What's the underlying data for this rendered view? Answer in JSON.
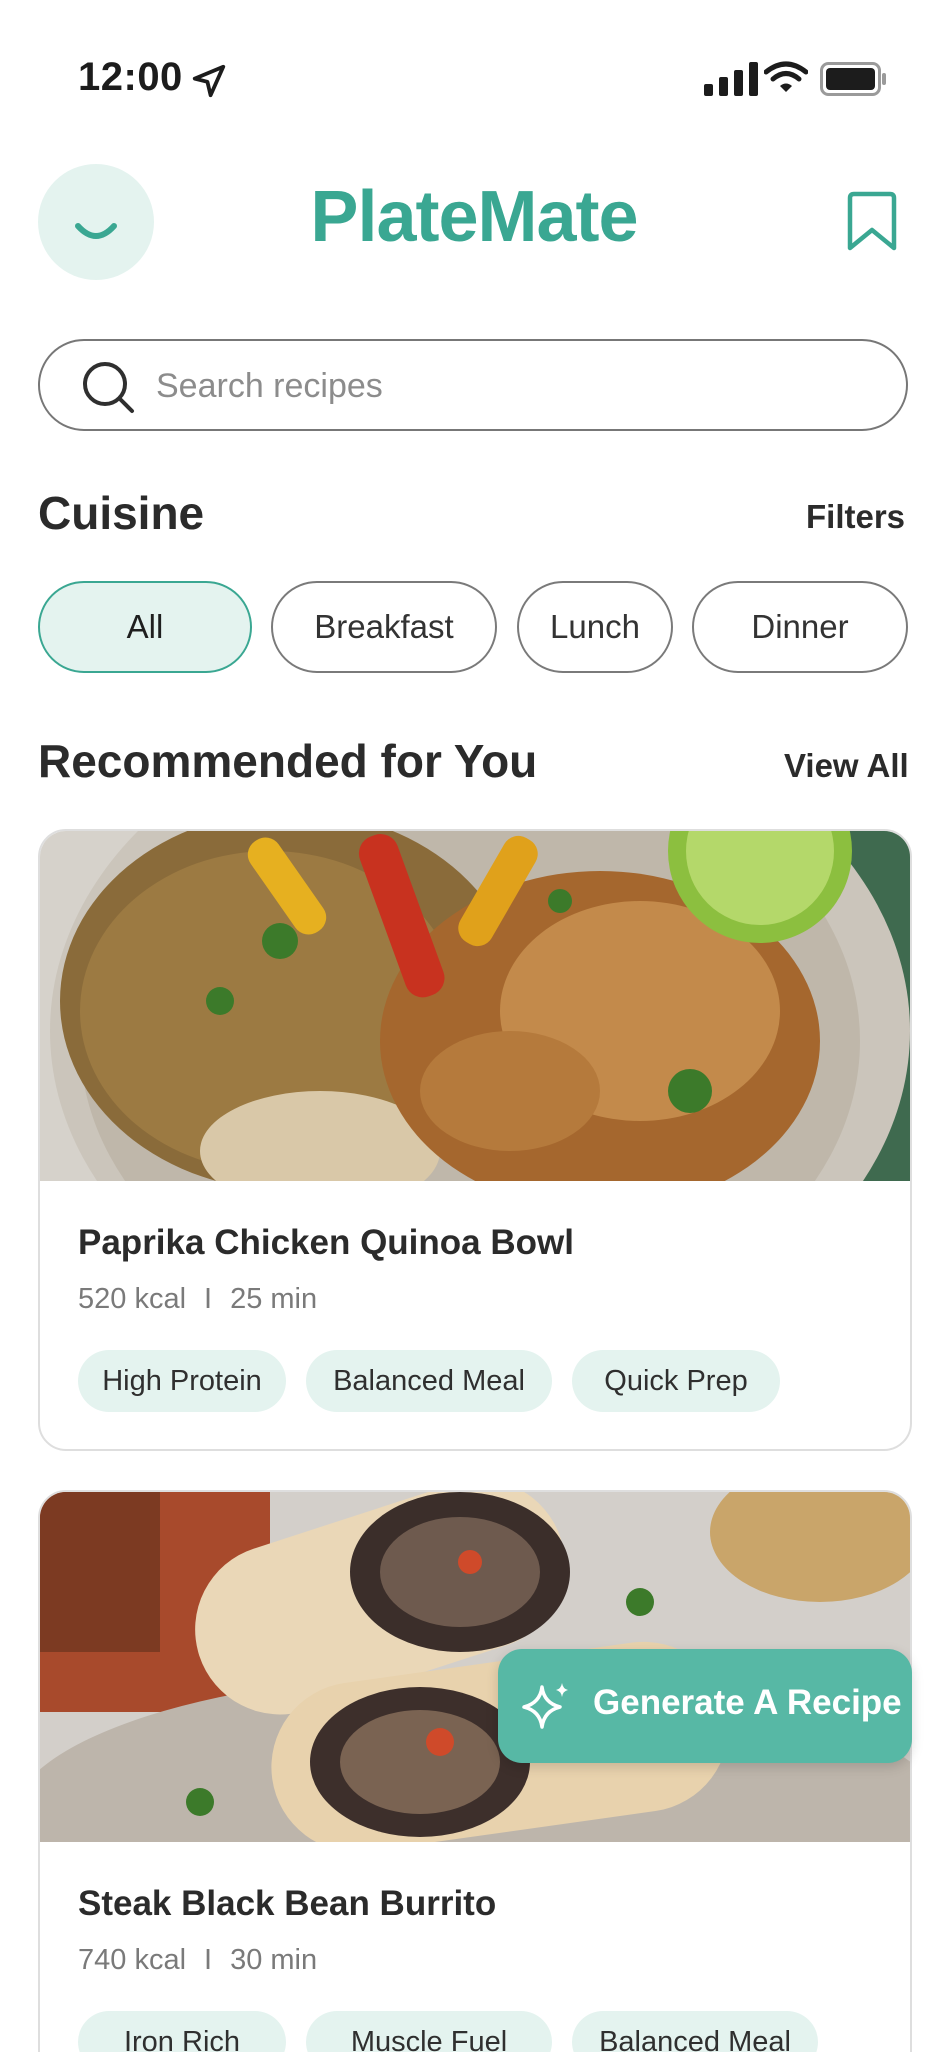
{
  "status_bar": {
    "time": "12:00"
  },
  "header": {
    "title": "PlateMate"
  },
  "search": {
    "placeholder": "Search recipes",
    "value": ""
  },
  "cuisine": {
    "title": "Cuisine",
    "filters_label": "Filters",
    "chips": [
      {
        "label": "All",
        "active": true
      },
      {
        "label": "Breakfast",
        "active": false
      },
      {
        "label": "Lunch",
        "active": false
      },
      {
        "label": "Dinner",
        "active": false
      }
    ]
  },
  "recommended": {
    "title": "Recommended for You",
    "view_all_label": "View All",
    "recipes": [
      {
        "name": "Paprika Chicken Quinoa Bowl",
        "kcal": "520 kcal",
        "separator": "I",
        "time": "25 min",
        "tags": [
          "High Protein",
          "Balanced Meal",
          "Quick Prep"
        ]
      },
      {
        "name": "Steak Black Bean Burrito",
        "kcal": "740 kcal",
        "separator": "I",
        "time": "30 min",
        "tags": [
          "Iron Rich",
          "Muscle Fuel",
          "Balanced Meal"
        ]
      }
    ]
  },
  "fab": {
    "label": "Generate A Recipe"
  },
  "colors": {
    "accent": "#3aa792",
    "accent_light": "#e4f3ef",
    "fab": "#57b8a5"
  },
  "icons": [
    "location-arrow-icon",
    "signal-icon",
    "wifi-icon",
    "battery-icon",
    "smile-icon",
    "bookmark-icon",
    "search-icon",
    "sparkle-icon"
  ]
}
